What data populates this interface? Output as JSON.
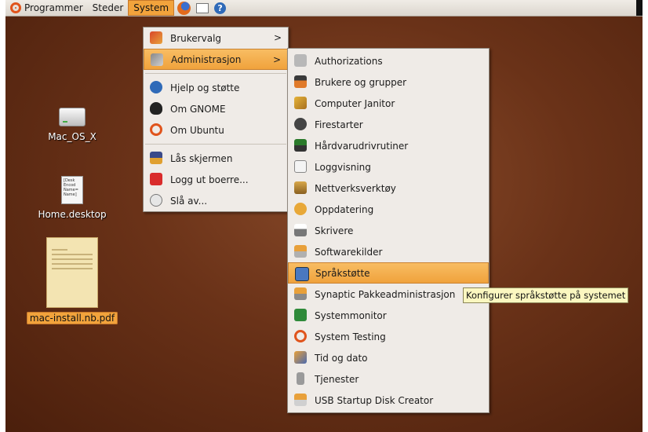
{
  "panel": {
    "menus": [
      "Programmer",
      "Steder",
      "System"
    ],
    "icons": [
      "ubuntu-logo-icon",
      "firefox-icon",
      "mail-icon",
      "help-icon"
    ]
  },
  "desktop": {
    "icons": [
      {
        "label": "Mac_OS_X",
        "icon": "hard-drive-icon"
      },
      {
        "label": "Home.desktop",
        "icon": "desktop-file-icon",
        "thumb_text": "[Desk Encod Name= Name]"
      },
      {
        "label": "mac-install.nb.pdf",
        "icon": "pdf-thumbnail-icon"
      }
    ]
  },
  "system_menu": {
    "items": [
      {
        "label": "Brukervalg",
        "icon": "preferences-icon",
        "submenu": true
      },
      {
        "label": "Administrasjon",
        "icon": "administration-icon",
        "submenu": true
      },
      {
        "label": "Hjelp og støtte",
        "icon": "help-icon"
      },
      {
        "label": "Om GNOME",
        "icon": "gnome-foot-icon"
      },
      {
        "label": "Om Ubuntu",
        "icon": "ubuntu-logo-icon"
      },
      {
        "label": "Lås skjermen",
        "icon": "lock-screen-icon"
      },
      {
        "label": "Logg ut boerre...",
        "icon": "logout-icon"
      },
      {
        "label": "Slå av...",
        "icon": "power-icon"
      }
    ]
  },
  "admin_menu": {
    "items": [
      {
        "label": "Authorizations",
        "icon": "keys-icon"
      },
      {
        "label": "Brukere og grupper",
        "icon": "users-groups-icon"
      },
      {
        "label": "Computer Janitor",
        "icon": "broom-icon"
      },
      {
        "label": "Firestarter",
        "icon": "firewall-icon"
      },
      {
        "label": "Hårdvarudrivrutiner",
        "icon": "hardware-driver-icon"
      },
      {
        "label": "Loggvisning",
        "icon": "log-viewer-icon"
      },
      {
        "label": "Nettverksverktøy",
        "icon": "network-tools-icon"
      },
      {
        "label": "Oppdatering",
        "icon": "update-icon"
      },
      {
        "label": "Skrivere",
        "icon": "printer-icon"
      },
      {
        "label": "Softwarekilder",
        "icon": "software-sources-icon"
      },
      {
        "label": "Språkstøtte",
        "icon": "language-support-icon"
      },
      {
        "label": "Synaptic Pakkeadministrasjon",
        "icon": "synaptic-icon"
      },
      {
        "label": "Systemmonitor",
        "icon": "system-monitor-icon"
      },
      {
        "label": "System Testing",
        "icon": "ubuntu-logo-icon"
      },
      {
        "label": "Tid og dato",
        "icon": "time-date-icon"
      },
      {
        "label": "Tjenester",
        "icon": "services-icon"
      },
      {
        "label": "USB Startup Disk Creator",
        "icon": "usb-creator-icon"
      }
    ]
  },
  "tooltip": "Konfigurer språkstøtte på systemet",
  "colors": {
    "highlight": "#f0a23c",
    "desktop": "#6a3218",
    "menu_bg": "#efebe7"
  }
}
